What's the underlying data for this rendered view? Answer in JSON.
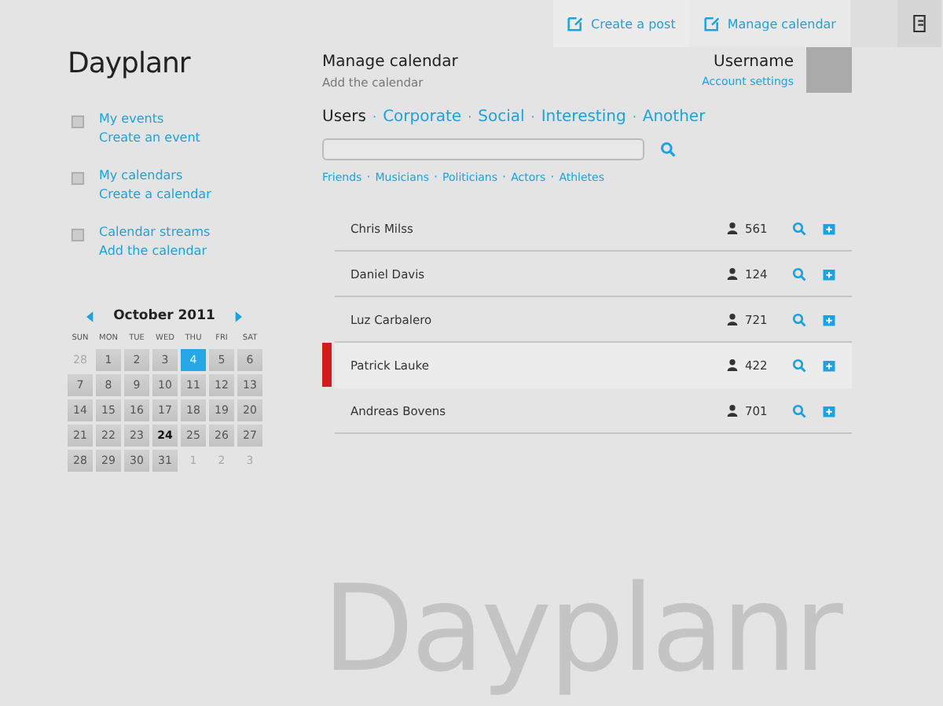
{
  "topbar": {
    "actions": [
      {
        "label": "Create a post"
      },
      {
        "label": "Manage calendar"
      }
    ]
  },
  "logo": "Dayplanr",
  "nav": [
    {
      "title": "My events",
      "action": "Create an event"
    },
    {
      "title": "My calendars",
      "action": "Create a calendar"
    },
    {
      "title": "Calendar streams",
      "action": "Add the calendar"
    }
  ],
  "calendar": {
    "month": "October 2011",
    "weekdays": [
      "SUN",
      "MON",
      "TUE",
      "WED",
      "THU",
      "FRI",
      "SAT"
    ],
    "days": [
      {
        "day": "28",
        "kind": "other",
        "selected": false
      },
      {
        "day": "1",
        "kind": "day",
        "selected": false
      },
      {
        "day": "2",
        "kind": "day",
        "selected": false
      },
      {
        "day": "3",
        "kind": "day",
        "selected": false
      },
      {
        "day": "4",
        "kind": "day",
        "selected": true
      },
      {
        "day": "5",
        "kind": "day",
        "selected": false
      },
      {
        "day": "6",
        "kind": "day",
        "selected": false
      },
      {
        "day": "7",
        "kind": "day",
        "selected": false
      },
      {
        "day": "8",
        "kind": "day",
        "selected": false
      },
      {
        "day": "9",
        "kind": "day",
        "selected": false
      },
      {
        "day": "10",
        "kind": "day",
        "selected": false
      },
      {
        "day": "11",
        "kind": "day",
        "selected": false
      },
      {
        "day": "12",
        "kind": "day",
        "selected": false
      },
      {
        "day": "13",
        "kind": "day",
        "selected": false
      },
      {
        "day": "14",
        "kind": "day",
        "selected": false
      },
      {
        "day": "15",
        "kind": "day",
        "selected": false
      },
      {
        "day": "16",
        "kind": "day",
        "selected": false
      },
      {
        "day": "17",
        "kind": "day",
        "selected": false
      },
      {
        "day": "18",
        "kind": "day",
        "selected": false
      },
      {
        "day": "19",
        "kind": "day",
        "selected": false
      },
      {
        "day": "20",
        "kind": "day",
        "selected": false
      },
      {
        "day": "21",
        "kind": "day",
        "selected": false
      },
      {
        "day": "22",
        "kind": "day",
        "selected": false
      },
      {
        "day": "23",
        "kind": "day",
        "selected": false
      },
      {
        "day": "24",
        "kind": "today",
        "selected": false
      },
      {
        "day": "25",
        "kind": "day",
        "selected": false
      },
      {
        "day": "26",
        "kind": "day",
        "selected": false
      },
      {
        "day": "27",
        "kind": "day",
        "selected": false
      },
      {
        "day": "28",
        "kind": "day",
        "selected": false
      },
      {
        "day": "29",
        "kind": "day",
        "selected": false
      },
      {
        "day": "30",
        "kind": "day",
        "selected": false
      },
      {
        "day": "31",
        "kind": "day",
        "selected": false
      },
      {
        "day": "1",
        "kind": "other",
        "selected": false
      },
      {
        "day": "2",
        "kind": "other",
        "selected": false
      },
      {
        "day": "3",
        "kind": "other",
        "selected": false
      }
    ]
  },
  "header": {
    "title": "Manage calendar",
    "subtitle": "Add the calendar"
  },
  "user": {
    "name": "Username",
    "link": "Account settings"
  },
  "tabs": [
    {
      "label": "Users",
      "selected": true
    },
    {
      "label": "Corporate",
      "selected": false
    },
    {
      "label": "Social",
      "selected": false
    },
    {
      "label": "Interesting",
      "selected": false
    },
    {
      "label": "Another",
      "selected": false
    }
  ],
  "filters": [
    "Friends",
    "Musicians",
    "Politicians",
    "Actors",
    "Athletes"
  ],
  "rows": [
    {
      "name": "Chris Milss",
      "count": "561",
      "selected": false
    },
    {
      "name": "Daniel Davis",
      "count": "124",
      "selected": false
    },
    {
      "name": "Luz Carbalero",
      "count": "721",
      "selected": false
    },
    {
      "name": "Patrick Lauke",
      "count": "422",
      "selected": true
    },
    {
      "name": "Andreas Bovens",
      "count": "701",
      "selected": false
    }
  ],
  "separator": "·",
  "watermark": "Dayplanr"
}
